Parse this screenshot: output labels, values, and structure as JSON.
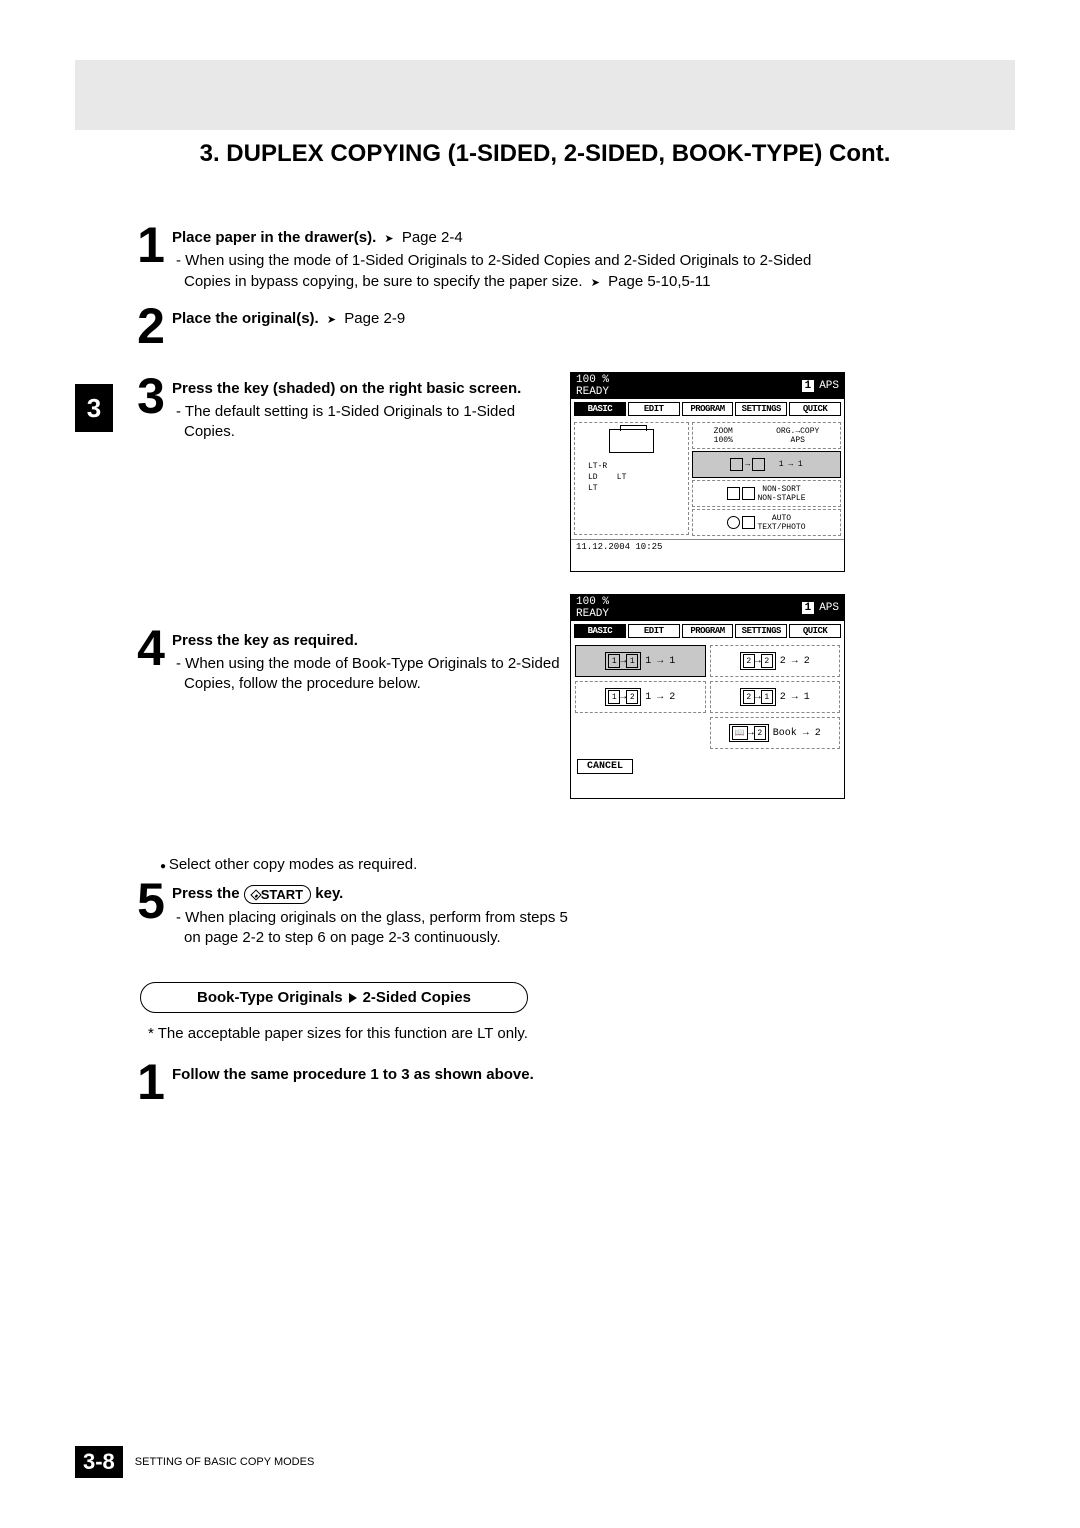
{
  "header": {
    "title": "3. DUPLEX COPYING (1-SIDED, 2-SIDED, BOOK-TYPE) Cont."
  },
  "chapter_tab": "3",
  "steps": {
    "s1": {
      "num": "1",
      "title": "Place paper in the drawer(s).",
      "ref": "Page 2-4",
      "line1": "- When using the mode of 1-Sided Originals to 2-Sided Copies and 2-Sided Originals to 2-Sided Copies in bypass copying, be sure to specify the paper size.",
      "ref2": "Page 5-10,5-11"
    },
    "s2": {
      "num": "2",
      "title": "Place the original(s).",
      "ref": "Page 2-9"
    },
    "s3": {
      "num": "3",
      "title": "Press the key (shaded) on the right basic screen.",
      "line1": "- The default setting is 1-Sided Originals to 1-Sided Copies."
    },
    "s4": {
      "num": "4",
      "title": "Press the key as required.",
      "line1": "- When using the mode of Book-Type Originals to 2-Sided Copies, follow the procedure below."
    },
    "bullet": "Select other copy modes as required.",
    "s5": {
      "num": "5",
      "title_a": "Press the ",
      "title_b": "START",
      "title_c": " key.",
      "line1": "- When placing originals on the glass, perform from steps 5 on page 2-2 to step 6 on page 2-3 continuously."
    }
  },
  "section": {
    "left": "Book-Type Originals",
    "right": "2-Sided Copies"
  },
  "note": "* The acceptable paper sizes for this function are LT only.",
  "steps2": {
    "s1": {
      "num": "1",
      "title": "Follow the same procedure 1 to 3 as shown above."
    }
  },
  "screen1": {
    "pct": "100 %",
    "ready": "READY",
    "count": "1",
    "aps": "APS",
    "tabs": [
      "BASIC",
      "EDIT",
      "PROGRAM",
      "SETTINGS",
      "QUICK"
    ],
    "zoom": "ZOOM",
    "zoom_val": "100%",
    "orig": "ORG.→COPY",
    "orig_aps": "APS",
    "papers": "LT-R\nLD    LT\nLT",
    "btn_11": "1 → 1",
    "btn_sort": "NON-SORT\nNON-STAPLE",
    "btn_auto": "AUTO\nTEXT/PHOTO",
    "timestamp": "11.12.2004 10:25"
  },
  "screen2": {
    "pct": "100 %",
    "ready": "READY",
    "count": "1",
    "aps": "APS",
    "tabs": [
      "BASIC",
      "EDIT",
      "PROGRAM",
      "SETTINGS",
      "QUICK"
    ],
    "m11": "1 → 1",
    "m22": "2 → 2",
    "m12": "1 → 2",
    "m21": "2 → 1",
    "mb2": "Book → 2",
    "cancel": "CANCEL"
  },
  "footer": {
    "pagenum": "3-8",
    "label": "SETTING OF BASIC COPY MODES"
  }
}
